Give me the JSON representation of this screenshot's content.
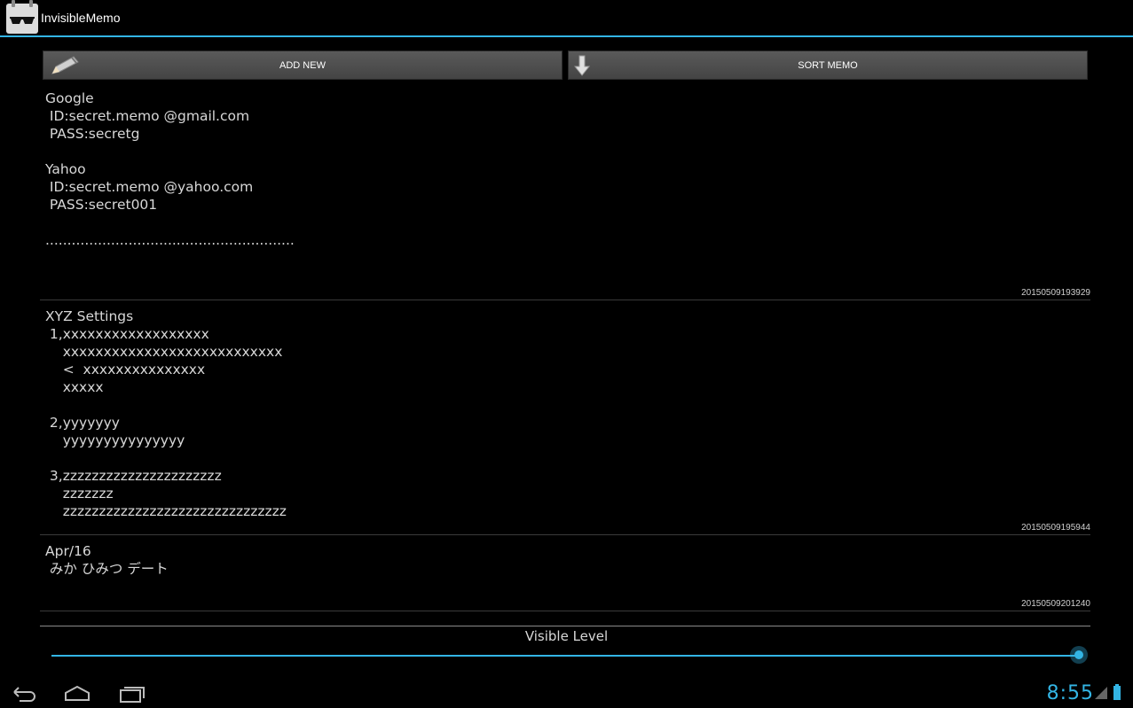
{
  "app": {
    "title": "InvisibleMemo"
  },
  "toolbar": {
    "add_new_label": "ADD NEW",
    "sort_memo_label": "SORT MEMO"
  },
  "memos": [
    {
      "body": "Google\n ID:secret.memo @gmail.com\n PASS:secretg\n\nYahoo\n ID:secret.memo @yahoo.com\n PASS:secret001\n\n.........................................................",
      "timestamp": "20150509193929"
    },
    {
      "body": "XYZ Settings\n 1,xxxxxxxxxxxxxxxxxx\n    xxxxxxxxxxxxxxxxxxxxxxxxxxx\n    <  xxxxxxxxxxxxxxx\n    xxxxx\n\n 2,yyyyyyy\n    yyyyyyyyyyyyyyy\n\n 3,zzzzzzzzzzzzzzzzzzzzzz\n    zzzzzzz\n    zzzzzzzzzzzzzzzzzzzzzzzzzzzzzzz",
      "timestamp": "20150509195944"
    },
    {
      "body": "Apr/16\n みか ひみつ デート",
      "timestamp": "20150509201240"
    }
  ],
  "visible_level": {
    "label": "Visible Level",
    "value_fraction": 1.0
  },
  "status": {
    "clock": "8:55"
  },
  "colors": {
    "accent": "#33b5e5",
    "background": "#000000"
  },
  "icons": [
    "pencil-icon",
    "down-arrow-icon",
    "back-icon",
    "home-icon",
    "recent-apps-icon",
    "signal-icon",
    "battery-icon"
  ]
}
